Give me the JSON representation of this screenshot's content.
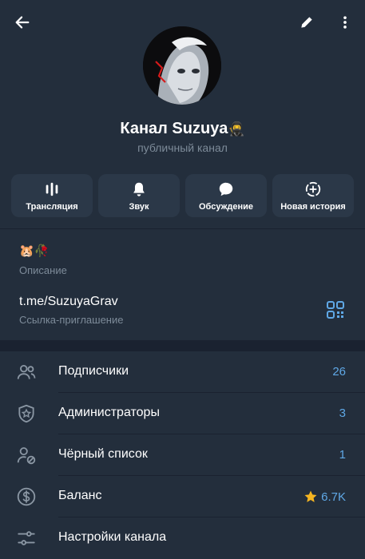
{
  "header": {
    "channel_name": "Канал Suzuya",
    "name_emoji": "🥷",
    "subtitle": "публичный канал"
  },
  "actions": [
    {
      "label": "Трансляция",
      "icon": "live-stream-icon"
    },
    {
      "label": "Звук",
      "icon": "bell-icon"
    },
    {
      "label": "Обсуждение",
      "icon": "chat-bubble-icon"
    },
    {
      "label": "Новая история",
      "icon": "story-plus-icon"
    }
  ],
  "info": {
    "description_emojis": "🐹🥀",
    "description_label": "Описание",
    "link": "t.me/SuzuyaGrav",
    "link_label": "Ссылка-приглашение"
  },
  "settings": {
    "subscribers_label": "Подписчики",
    "subscribers_value": "26",
    "admins_label": "Администраторы",
    "admins_value": "3",
    "blacklist_label": "Чёрный список",
    "blacklist_value": "1",
    "balance_label": "Баланс",
    "balance_value": "6.7K",
    "channel_settings_label": "Настройки канала"
  },
  "colors": {
    "background": "#1a2230",
    "surface": "#232e3c",
    "button": "#2b3848",
    "accent": "#5fa8e6",
    "muted": "#7d8b99",
    "star": "#f5b521"
  }
}
